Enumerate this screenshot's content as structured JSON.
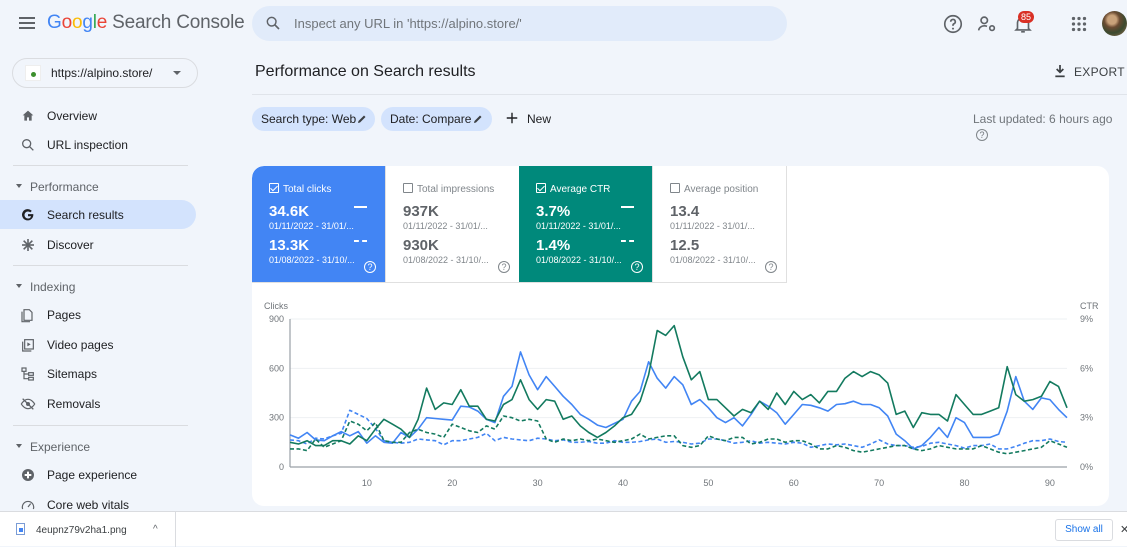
{
  "app": {
    "title_google": "Google",
    "title_product": "Search Console"
  },
  "search": {
    "placeholder": "Inspect any URL in 'https://alpino.store/'"
  },
  "header": {
    "notification_count": "85"
  },
  "property": {
    "url": "https://alpino.store/"
  },
  "sidebar": {
    "items": [
      {
        "label": "Overview",
        "icon": "home-icon"
      },
      {
        "label": "URL inspection",
        "icon": "search-icon"
      }
    ],
    "sections": [
      {
        "label": "Performance",
        "items": [
          {
            "label": "Search results",
            "icon": "google-g-icon",
            "active": true
          },
          {
            "label": "Discover",
            "icon": "asterisk-icon"
          }
        ]
      },
      {
        "label": "Indexing",
        "items": [
          {
            "label": "Pages",
            "icon": "pages-icon"
          },
          {
            "label": "Video pages",
            "icon": "video-pages-icon"
          },
          {
            "label": "Sitemaps",
            "icon": "sitemap-icon"
          },
          {
            "label": "Removals",
            "icon": "eye-off-icon"
          }
        ]
      },
      {
        "label": "Experience",
        "items": [
          {
            "label": "Page experience",
            "icon": "page-experience-icon"
          },
          {
            "label": "Core web vitals",
            "icon": "gauge-icon"
          }
        ]
      }
    ]
  },
  "main": {
    "title": "Performance on Search results",
    "export_label": "EXPORT",
    "filters": [
      {
        "label": "Search type: Web"
      },
      {
        "label": "Date: Compare"
      }
    ],
    "new_label": "New",
    "last_updated": "Last updated: 6 hours ago"
  },
  "metrics": [
    {
      "label": "Total clicks",
      "checked": true,
      "current": "34.6K",
      "current_range": "01/11/2022 - 31/01/...",
      "previous": "13.3K",
      "previous_range": "01/08/2022 - 31/10/...",
      "color": "#4285f4"
    },
    {
      "label": "Total impressions",
      "checked": false,
      "current": "937K",
      "current_range": "01/11/2022 - 31/01/...",
      "previous": "930K",
      "previous_range": "01/08/2022 - 31/10/...",
      "color": "#5e35b1"
    },
    {
      "label": "Average CTR",
      "checked": true,
      "current": "3.7%",
      "current_range": "01/11/2022 - 31/01/...",
      "previous": "1.4%",
      "previous_range": "01/08/2022 - 31/10/...",
      "color": "#00897b"
    },
    {
      "label": "Average position",
      "checked": false,
      "current": "13.4",
      "current_range": "01/11/2022 - 31/01/...",
      "previous": "12.5",
      "previous_range": "01/08/2022 - 31/10/...",
      "color": "#e8710a"
    }
  ],
  "chart_data": {
    "type": "line",
    "ylabel_left": "Clicks",
    "ylabel_right": "CTR",
    "ylim_left": [
      0,
      900
    ],
    "ylim_right": [
      0,
      9
    ],
    "yticks_left": [
      "0",
      "300",
      "600",
      "900"
    ],
    "yticks_right": [
      "0%",
      "3%",
      "6%",
      "9%"
    ],
    "xlim": [
      1,
      92
    ],
    "xticks": [
      10,
      20,
      30,
      40,
      50,
      60,
      70,
      80,
      90
    ],
    "grid": true,
    "legend": "none",
    "series": [
      {
        "name": "Clicks (01/11/2022 - 31/01/...)",
        "axis": "left",
        "color": "#4285f4",
        "dashed": false,
        "values": [
          195,
          175,
          210,
          165,
          160,
          190,
          215,
          190,
          215,
          145,
          190,
          150,
          145,
          210,
          180,
          230,
          300,
          295,
          290,
          285,
          370,
          365,
          340,
          290,
          270,
          430,
          490,
          700,
          560,
          470,
          550,
          490,
          430,
          380,
          320,
          290,
          255,
          240,
          265,
          290,
          400,
          460,
          640,
          540,
          480,
          550,
          500,
          380,
          410,
          360,
          300,
          270,
          300,
          250,
          320,
          400,
          370,
          330,
          260,
          320,
          380,
          375,
          360,
          340,
          380,
          385,
          400,
          380,
          380,
          360,
          310,
          200,
          160,
          110,
          130,
          180,
          240,
          180,
          300,
          270,
          180,
          180,
          180,
          200,
          340,
          550,
          400,
          350,
          420,
          410,
          350,
          300
        ]
      },
      {
        "name": "Clicks (01/08/2022 - 31/10/...)",
        "axis": "left",
        "color": "#4285f4",
        "dashed": true,
        "values": [
          165,
          160,
          140,
          175,
          170,
          190,
          205,
          345,
          320,
          295,
          235,
          160,
          150,
          145,
          150,
          170,
          165,
          160,
          135,
          160,
          160,
          170,
          180,
          205,
          160,
          180,
          170,
          165,
          160,
          175,
          170,
          160,
          165,
          150,
          150,
          155,
          145,
          145,
          160,
          150,
          150,
          155,
          165,
          170,
          150,
          155,
          150,
          140,
          145,
          170,
          170,
          160,
          145,
          150,
          160,
          145,
          150,
          145,
          140,
          150,
          145,
          120,
          130,
          140,
          135,
          140,
          130,
          120,
          140,
          165,
          140,
          130,
          130,
          120,
          125,
          145,
          150,
          140,
          130,
          115,
          130,
          130,
          140,
          110,
          110,
          125,
          145,
          160,
          160,
          170,
          155,
          150
        ]
      },
      {
        "name": "CTR (01/11/2022 - 31/01/...)",
        "axis": "right",
        "color": "#137a5f",
        "dashed": false,
        "values": [
          1.5,
          1.4,
          1.6,
          1.3,
          1.3,
          1.6,
          1.6,
          1.4,
          1.9,
          1.6,
          2.3,
          2.9,
          2.6,
          2.3,
          1.8,
          2.9,
          4.8,
          3.5,
          3.9,
          3.8,
          4.7,
          3.7,
          3.7,
          2.9,
          2.8,
          3.8,
          4.1,
          5.3,
          4.1,
          3.5,
          4.1,
          4.0,
          2.9,
          3.1,
          2.5,
          2.1,
          1.8,
          2.1,
          2.5,
          3.0,
          3.2,
          4.0,
          5.6,
          8.3,
          8.0,
          8.6,
          6.7,
          5.3,
          5.8,
          4.1,
          4.1,
          3.6,
          3.1,
          3.5,
          3.3,
          4.0,
          3.5,
          4.5,
          3.8,
          4.6,
          4.1,
          4.4,
          3.9,
          4.6,
          4.6,
          5.4,
          5.8,
          5.5,
          5.8,
          5.6,
          5.1,
          3.2,
          3.4,
          2.4,
          3.3,
          3.2,
          3.2,
          2.8,
          4.4,
          3.8,
          3.2,
          3.2,
          3.4,
          3.6,
          6.1,
          4.4,
          4.0,
          4.1,
          4.3,
          5.2,
          4.9,
          3.6
        ]
      },
      {
        "name": "CTR (01/08/2022 - 31/10/...)",
        "axis": "right",
        "color": "#137a5f",
        "dashed": true,
        "values": [
          1.1,
          1.1,
          1.0,
          1.7,
          1.2,
          1.4,
          1.6,
          2.8,
          2.6,
          2.2,
          2.7,
          1.6,
          1.5,
          1.5,
          2.1,
          2.3,
          2.1,
          2.0,
          1.8,
          2.6,
          2.4,
          2.2,
          2.1,
          2.5,
          2.3,
          3.1,
          3.0,
          2.8,
          2.9,
          2.8,
          1.7,
          1.5,
          1.7,
          1.6,
          1.7,
          1.6,
          1.7,
          1.6,
          1.5,
          1.6,
          1.7,
          2.0,
          1.7,
          1.8,
          1.9,
          1.9,
          1.3,
          1.2,
          1.3,
          1.9,
          1.7,
          1.6,
          1.8,
          1.8,
          1.4,
          1.5,
          1.7,
          1.7,
          1.5,
          1.6,
          1.6,
          1.4,
          1.1,
          1.1,
          1.3,
          1.2,
          1.0,
          0.9,
          1.0,
          1.1,
          1.2,
          1.3,
          1.3,
          1.1,
          1.0,
          1.1,
          1.3,
          1.2,
          1.1,
          1.1,
          1.1,
          1.3,
          1.1,
          0.9,
          0.8,
          0.9,
          1.0,
          1.1,
          1.2,
          1.6,
          1.4,
          1.2
        ]
      }
    ]
  },
  "download_bar": {
    "filename": "4eupnz79v2ha1.png",
    "show_all": "Show all"
  }
}
